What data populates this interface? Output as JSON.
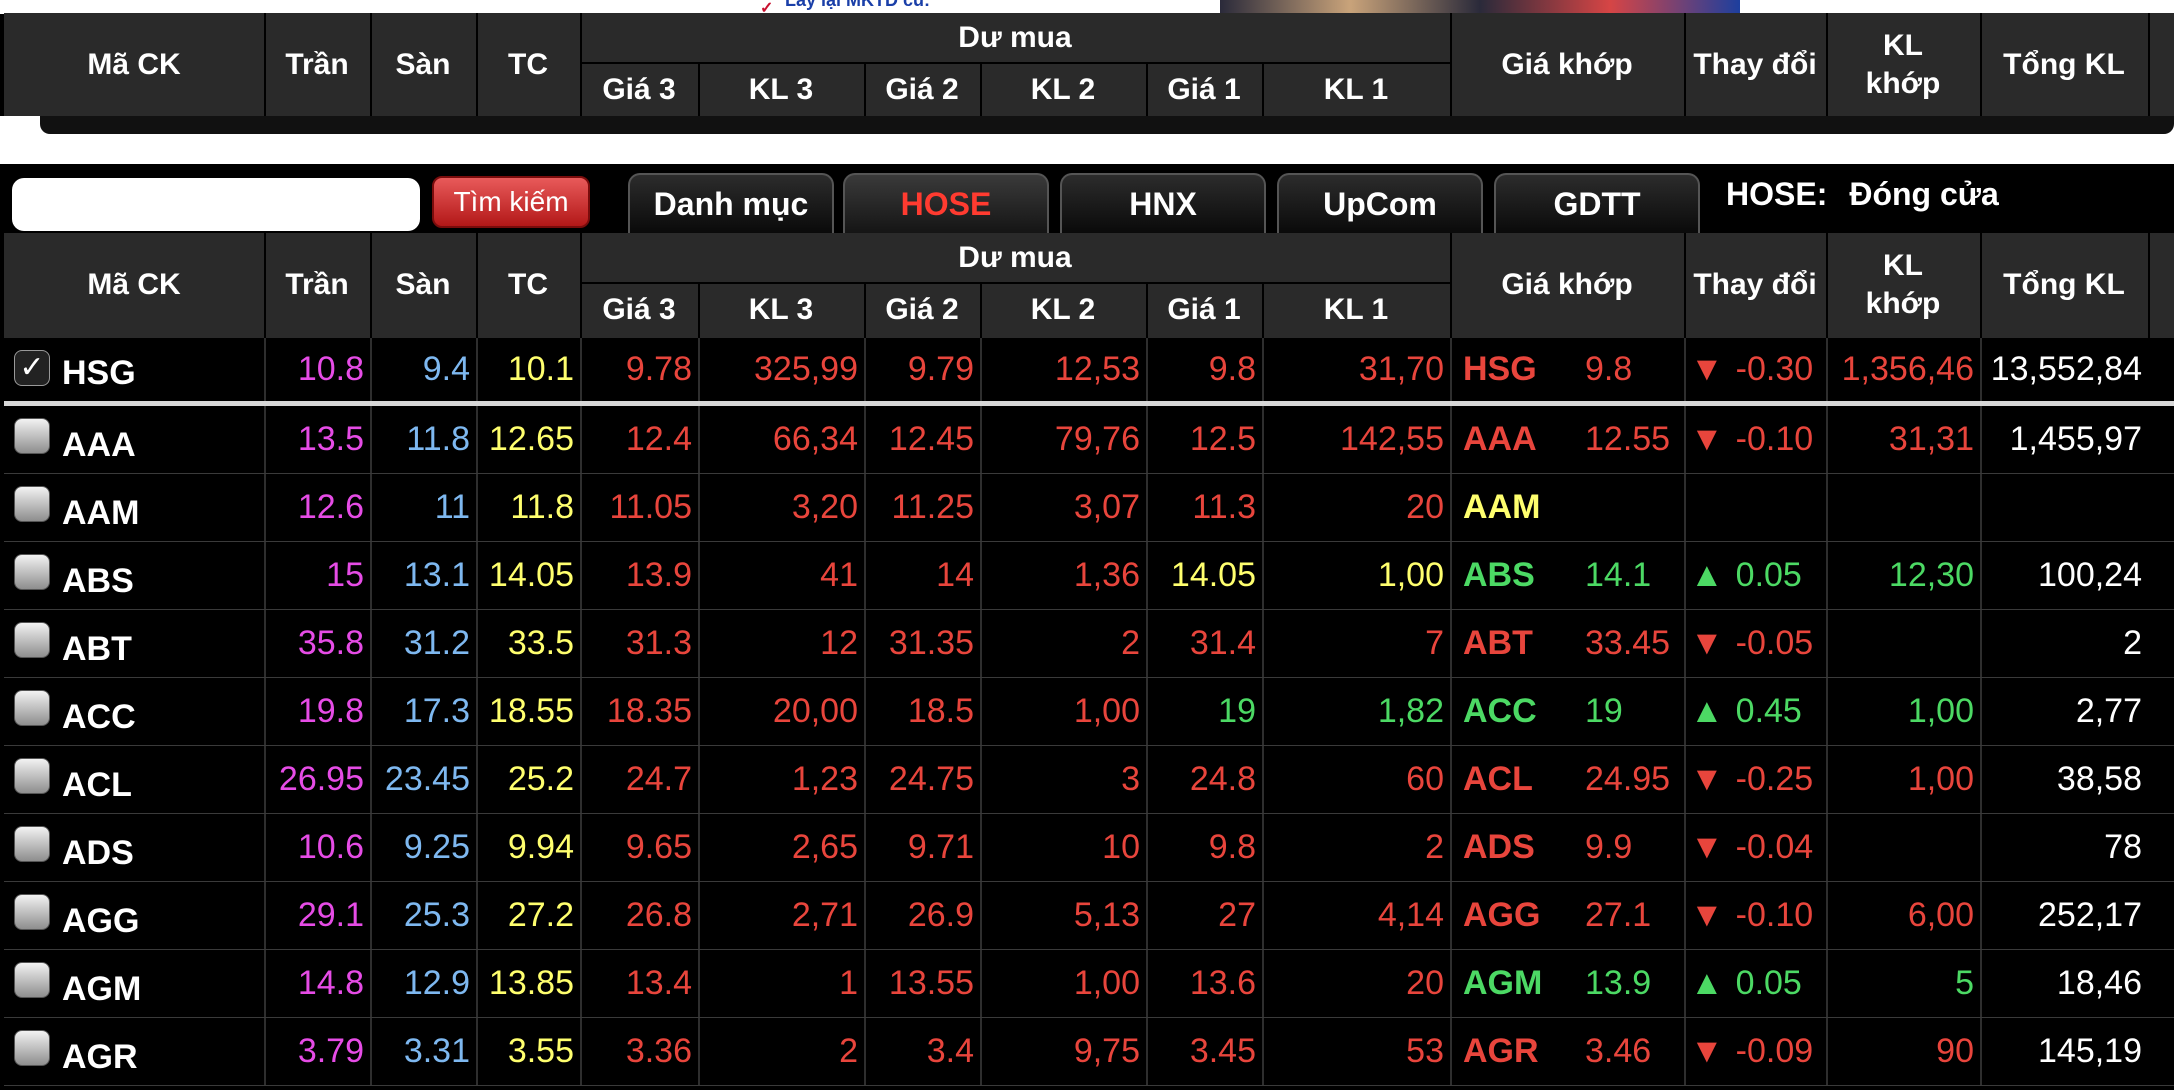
{
  "banner": {
    "text": "Lấy lại MKTD cũ:"
  },
  "headers": {
    "ma_ck": "Mã CK",
    "tran": "Trần",
    "san": "Sàn",
    "tc": "TC",
    "du_mua": "Dư mua",
    "gia3": "Giá 3",
    "kl3": "KL 3",
    "gia2": "Giá 2",
    "kl2": "KL 2",
    "gia1": "Giá 1",
    "kl1": "KL 1",
    "gia_khop": "Giá khớp",
    "thay_doi": "Thay đổi",
    "kl_khop": "KL khớp",
    "tong_kl": "Tổng KL"
  },
  "toolbar": {
    "search_value": "",
    "search_button": "Tìm kiếm",
    "tabs": [
      "Danh mục",
      "HOSE",
      "HNX",
      "UpCom",
      "GDTT"
    ],
    "active_tab": "HOSE",
    "exchange_label": "HOSE:",
    "exchange_status": "Đóng cửa"
  },
  "colors": {
    "up": "#4cd964",
    "down": "#e8453c",
    "ref": "#ffff6e",
    "ceiling": "#e64ce6",
    "floor": "#7eb8f0"
  },
  "rows": [
    {
      "sym": "HSG",
      "checked": true,
      "tran": "10.8",
      "san": "9.4",
      "tc": "10.1",
      "g3": "9.78",
      "k3": "325,99",
      "g2": "9.79",
      "k2": "12,53",
      "g1": "9.8",
      "k1": "31,70",
      "gk": "9.8",
      "arrow": "▼",
      "td": "-0.30",
      "klk": "1,356,46",
      "tong": "13,552,84",
      "dir": "down",
      "g1c": "r",
      "k1c": "r"
    },
    {
      "sym": "AAA",
      "checked": false,
      "tran": "13.5",
      "san": "11.8",
      "tc": "12.65",
      "g3": "12.4",
      "k3": "66,34",
      "g2": "12.45",
      "k2": "79,76",
      "g1": "12.5",
      "k1": "142,55",
      "gk": "12.55",
      "arrow": "▼",
      "td": "-0.10",
      "klk": "31,31",
      "tong": "1,455,97",
      "dir": "down",
      "g1c": "r",
      "k1c": "r"
    },
    {
      "sym": "AAM",
      "checked": false,
      "tran": "12.6",
      "san": "11",
      "tc": "11.8",
      "g3": "11.05",
      "k3": "3,20",
      "g2": "11.25",
      "k2": "3,07",
      "g1": "11.3",
      "k1": "20",
      "gk": "",
      "arrow": "",
      "td": "",
      "klk": "",
      "tong": "",
      "dir": "ref",
      "g1c": "r",
      "k1c": "r"
    },
    {
      "sym": "ABS",
      "checked": false,
      "tran": "15",
      "san": "13.1",
      "tc": "14.05",
      "g3": "13.9",
      "k3": "41",
      "g2": "14",
      "k2": "1,36",
      "g1": "14.05",
      "k1": "1,00",
      "gk": "14.1",
      "arrow": "▲",
      "td": "0.05",
      "klk": "12,30",
      "tong": "100,24",
      "dir": "up",
      "g1c": "y",
      "k1c": "y"
    },
    {
      "sym": "ABT",
      "checked": false,
      "tran": "35.8",
      "san": "31.2",
      "tc": "33.5",
      "g3": "31.3",
      "k3": "12",
      "g2": "31.35",
      "k2": "2",
      "g1": "31.4",
      "k1": "7",
      "gk": "33.45",
      "arrow": "▼",
      "td": "-0.05",
      "klk": "",
      "tong": "2",
      "dir": "down",
      "g1c": "r",
      "k1c": "r"
    },
    {
      "sym": "ACC",
      "checked": false,
      "tran": "19.8",
      "san": "17.3",
      "tc": "18.55",
      "g3": "18.35",
      "k3": "20,00",
      "g2": "18.5",
      "k2": "1,00",
      "g1": "19",
      "k1": "1,82",
      "gk": "19",
      "arrow": "▲",
      "td": "0.45",
      "klk": "1,00",
      "tong": "2,77",
      "dir": "up",
      "g1c": "g",
      "k1c": "g"
    },
    {
      "sym": "ACL",
      "checked": false,
      "tran": "26.95",
      "san": "23.45",
      "tc": "25.2",
      "g3": "24.7",
      "k3": "1,23",
      "g2": "24.75",
      "k2": "3",
      "g1": "24.8",
      "k1": "60",
      "gk": "24.95",
      "arrow": "▼",
      "td": "-0.25",
      "klk": "1,00",
      "tong": "38,58",
      "dir": "down",
      "g1c": "r",
      "k1c": "r"
    },
    {
      "sym": "ADS",
      "checked": false,
      "tran": "10.6",
      "san": "9.25",
      "tc": "9.94",
      "g3": "9.65",
      "k3": "2,65",
      "g2": "9.71",
      "k2": "10",
      "g1": "9.8",
      "k1": "2",
      "gk": "9.9",
      "arrow": "▼",
      "td": "-0.04",
      "klk": "",
      "tong": "78",
      "dir": "down",
      "g1c": "r",
      "k1c": "r"
    },
    {
      "sym": "AGG",
      "checked": false,
      "tran": "29.1",
      "san": "25.3",
      "tc": "27.2",
      "g3": "26.8",
      "k3": "2,71",
      "g2": "26.9",
      "k2": "5,13",
      "g1": "27",
      "k1": "4,14",
      "gk": "27.1",
      "arrow": "▼",
      "td": "-0.10",
      "klk": "6,00",
      "tong": "252,17",
      "dir": "down",
      "g1c": "r",
      "k1c": "r"
    },
    {
      "sym": "AGM",
      "checked": false,
      "tran": "14.8",
      "san": "12.9",
      "tc": "13.85",
      "g3": "13.4",
      "k3": "1",
      "g2": "13.55",
      "k2": "1,00",
      "g1": "13.6",
      "k1": "20",
      "gk": "13.9",
      "arrow": "▲",
      "td": "0.05",
      "klk": "5",
      "tong": "18,46",
      "dir": "up",
      "g1c": "r",
      "k1c": "r"
    },
    {
      "sym": "AGR",
      "checked": false,
      "tran": "3.79",
      "san": "3.31",
      "tc": "3.55",
      "g3": "3.36",
      "k3": "2",
      "g2": "3.4",
      "k2": "9,75",
      "g1": "3.45",
      "k1": "53",
      "gk": "3.46",
      "arrow": "▼",
      "td": "-0.09",
      "klk": "90",
      "tong": "145,19",
      "dir": "down",
      "g1c": "r",
      "k1c": "r"
    }
  ]
}
